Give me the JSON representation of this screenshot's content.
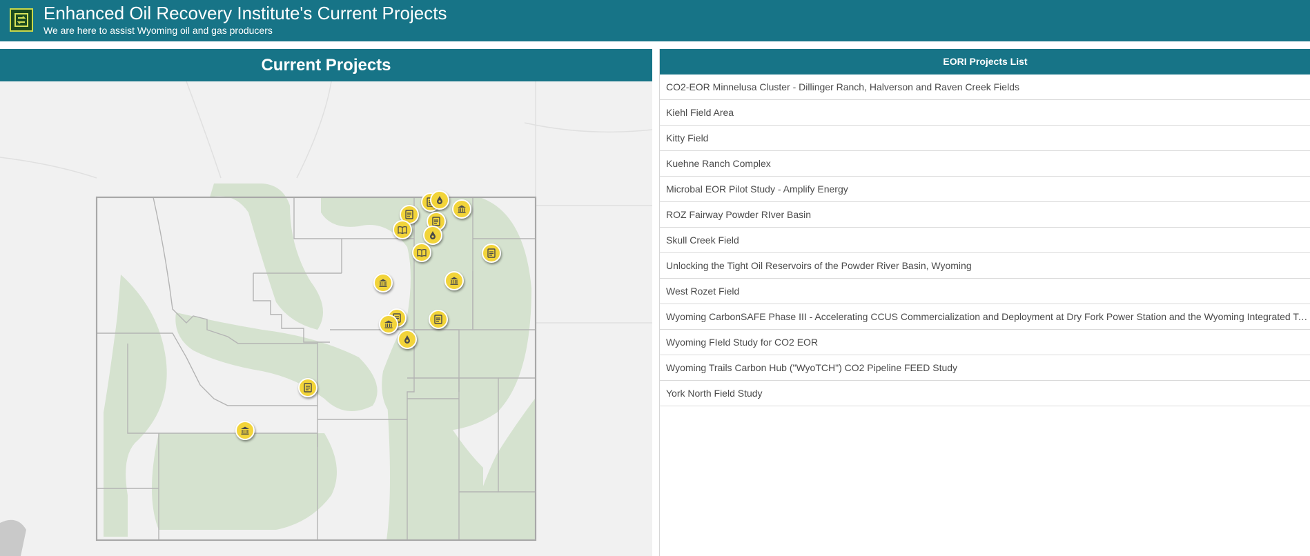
{
  "header": {
    "title": "Enhanced Oil Recovery Institute's Current Projects",
    "subtitle": "We are here to assist Wyoming oil and gas producers",
    "logo_icon": "refresh-arrows-icon",
    "background_color": "#177487"
  },
  "map_panel": {
    "heading": "Current Projects",
    "marker_color": "#f2d43a",
    "markers": [
      {
        "icon": "document-icon",
        "lon": 0.761,
        "lat": 0.255
      },
      {
        "icon": "droplet-icon",
        "lon": 0.781,
        "lat": 0.249
      },
      {
        "icon": "document-icon",
        "lon": 0.712,
        "lat": 0.291
      },
      {
        "icon": "bank-icon",
        "lon": 0.831,
        "lat": 0.276
      },
      {
        "icon": "document-icon",
        "lon": 0.773,
        "lat": 0.312
      },
      {
        "icon": "book-icon",
        "lon": 0.697,
        "lat": 0.336
      },
      {
        "icon": "droplet-icon",
        "lon": 0.765,
        "lat": 0.352
      },
      {
        "icon": "book-icon",
        "lon": 0.74,
        "lat": 0.402
      },
      {
        "icon": "document-icon",
        "lon": 0.9,
        "lat": 0.405
      },
      {
        "icon": "bank-icon",
        "lon": 0.653,
        "lat": 0.491
      },
      {
        "icon": "bank-icon",
        "lon": 0.814,
        "lat": 0.484
      },
      {
        "icon": "document-icon",
        "lon": 0.684,
        "lat": 0.594
      },
      {
        "icon": "bank-icon",
        "lon": 0.665,
        "lat": 0.612
      },
      {
        "icon": "document-icon",
        "lon": 0.778,
        "lat": 0.598
      },
      {
        "icon": "droplet-icon",
        "lon": 0.707,
        "lat": 0.656
      },
      {
        "icon": "document-icon",
        "lon": 0.481,
        "lat": 0.797
      },
      {
        "icon": "bank-icon",
        "lon": 0.338,
        "lat": 0.921
      }
    ]
  },
  "projects_panel": {
    "heading": "EORI Projects List",
    "items": [
      "CO2-EOR Minnelusa Cluster - Dillinger Ranch, Halverson and Raven Creek Fields",
      "Kiehl Field Area",
      "Kitty Field",
      "Kuehne Ranch Complex",
      "Microbal EOR Pilot Study - Amplify Energy",
      "ROZ Fairway Powder RIver Basin",
      "Skull Creek Field",
      "Unlocking the Tight Oil Reservoirs of the Powder River Basin, Wyoming",
      "West Rozet Field",
      "Wyoming CarbonSAFE Phase III - Accelerating CCUS Commercialization and Deployment at Dry Fork Power Station and the Wyoming Integrated Test Center",
      "Wyoming FIeld Study for CO2 EOR",
      "Wyoming Trails Carbon Hub (\"WyoTCH\") CO2 Pipeline FEED Study",
      "York North Field Study"
    ]
  }
}
